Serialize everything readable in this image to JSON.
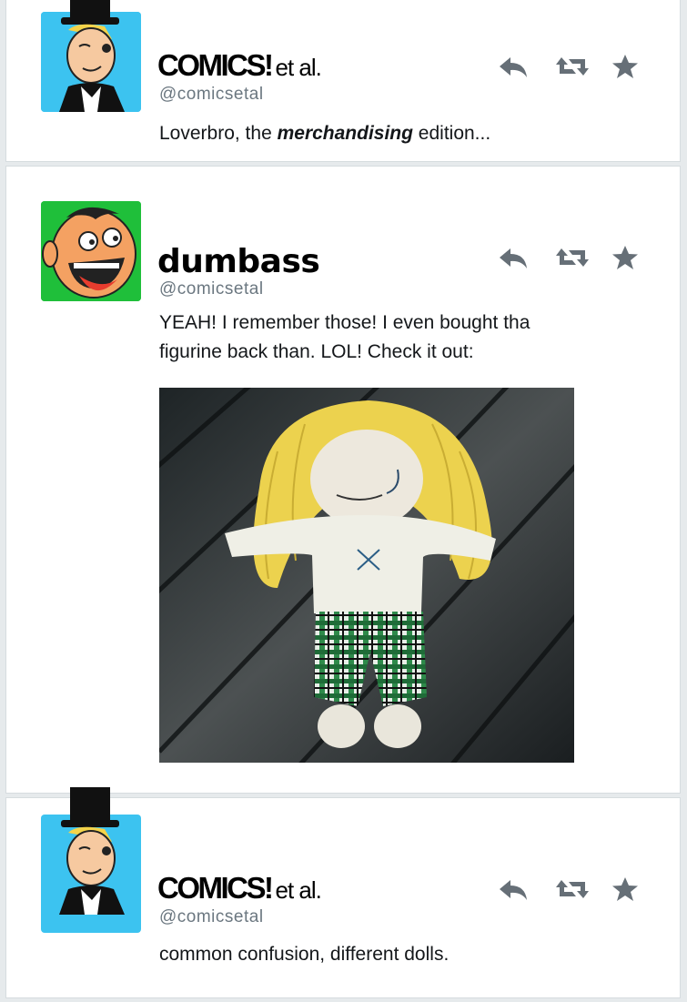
{
  "tweets": [
    {
      "display_name": "COMICS!",
      "display_suffix": "et al.",
      "handle": "@comicsetal",
      "text_before": "Loverbro, the ",
      "text_emphasis": "merchandising",
      "text_after": " edition...",
      "avatar_color": "#3cc3f0"
    },
    {
      "display_name": "dumbass",
      "handle": "@comicsetal",
      "text": "YEAH! I remember those! I even bought tha figurine back than. LOL! Check it out:",
      "avatar_color": "#1fbf3a"
    },
    {
      "display_name": "COMICS!",
      "display_suffix": "et al.",
      "handle": "@comicsetal",
      "text": "common confusion, different dolls.",
      "avatar_color": "#3cc3f0"
    }
  ],
  "icons": [
    "reply-icon",
    "retweet-icon",
    "favorite-icon"
  ],
  "colors": {
    "icon": "#666f77",
    "handle": "#6b7780",
    "border": "#d6dcdf"
  }
}
